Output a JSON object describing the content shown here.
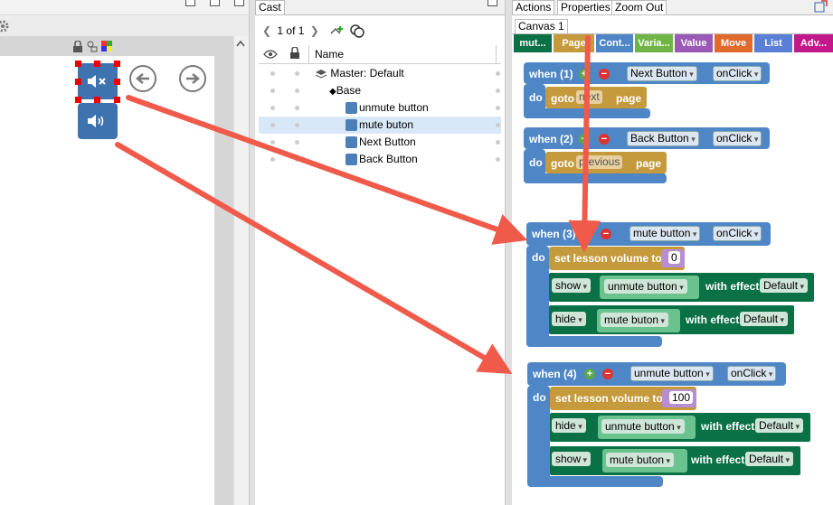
{
  "cast": {
    "tab": "Cast",
    "pager": "1 of 1",
    "column_name": "Name",
    "rows": [
      {
        "label": "Master: Default"
      },
      {
        "label": "Base"
      },
      {
        "label": "unmute button"
      },
      {
        "label": "mute buton"
      },
      {
        "label": "Next Button"
      },
      {
        "label": "Back Button"
      }
    ]
  },
  "blocks": {
    "tabs": [
      "Actions",
      "Properties",
      "Zoom Out"
    ],
    "canvas_tab": "Canvas 1",
    "categories": [
      {
        "label": "mut...",
        "color": "#0a7045"
      },
      {
        "label": "Page",
        "color": "#c49a3c"
      },
      {
        "label": "Cont...",
        "color": "#4f86c6"
      },
      {
        "label": "Varia...",
        "color": "#6fb545"
      },
      {
        "label": "Value",
        "color": "#9a59b5"
      },
      {
        "label": "Move",
        "color": "#e06a2c"
      },
      {
        "label": "List",
        "color": "#5a7fd6"
      },
      {
        "label": "Adv...",
        "color": "#c2188c"
      }
    ],
    "kw_when": "when",
    "kw_do": "do",
    "kw_goto": "goto",
    "kw_page": "page",
    "kw_with_effect": "with effect",
    "kw_set_volume": "set lesson volume to",
    "onclick": "onClick",
    "effect_default": "Default",
    "show": "show",
    "hide": "hide",
    "b1": {
      "num": "(1)",
      "target": "Next Button",
      "page": "next"
    },
    "b2": {
      "num": "(2)",
      "target": "Back Button",
      "page": "previous"
    },
    "b3": {
      "num": "(3)",
      "target": "mute button",
      "volume": "0",
      "show_target": "unmute button",
      "hide_target": "mute buton"
    },
    "b4": {
      "num": "(4)",
      "target": "unmute button",
      "volume": "100",
      "hide_target": "unmute button",
      "show_target": "mute buton"
    }
  },
  "colors": {
    "event_blue": "#4f86c6",
    "arrow_red": "#f05a4a"
  }
}
